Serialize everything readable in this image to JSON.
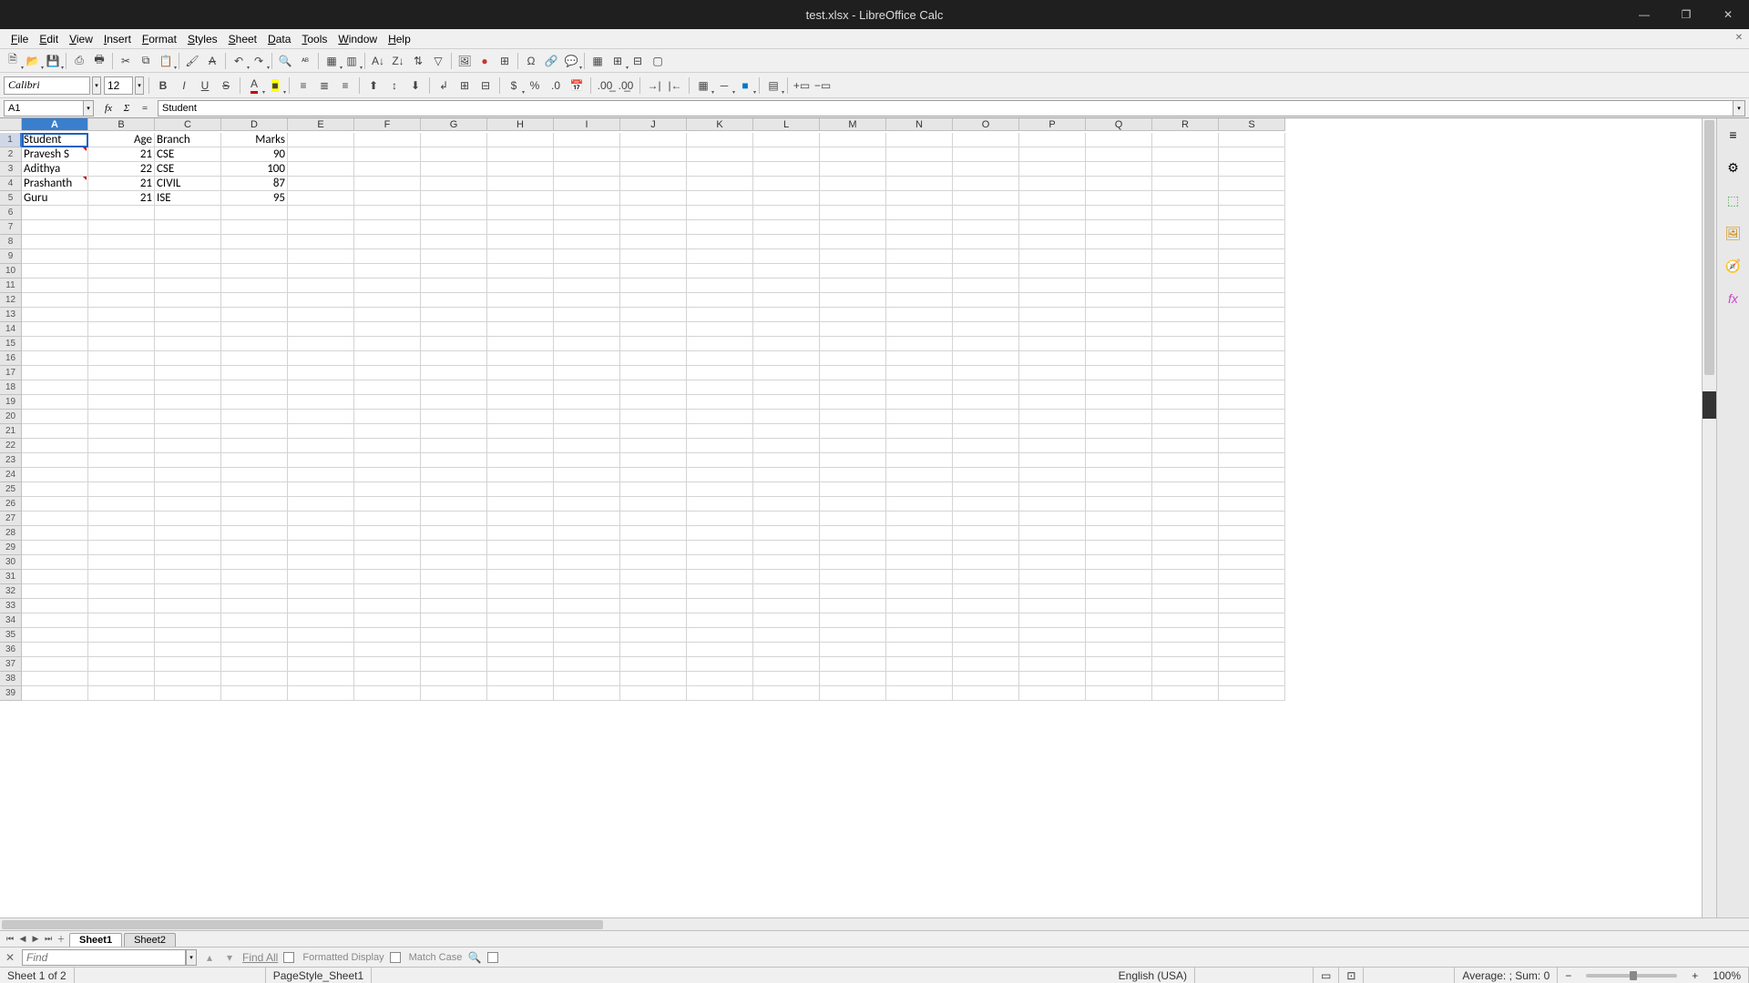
{
  "window": {
    "title": "test.xlsx - LibreOffice Calc"
  },
  "menu": [
    "File",
    "Edit",
    "View",
    "Insert",
    "Format",
    "Styles",
    "Sheet",
    "Data",
    "Tools",
    "Window",
    "Help"
  ],
  "font": {
    "name": "Calibri",
    "size": "12"
  },
  "namebox": "A1",
  "formula": "Student",
  "columns": [
    "A",
    "B",
    "C",
    "D",
    "E",
    "F",
    "G",
    "H",
    "I",
    "J",
    "K",
    "L",
    "M",
    "N",
    "O",
    "P",
    "Q",
    "R",
    "S"
  ],
  "selected_col": "A",
  "selected_row": 1,
  "rows": 39,
  "cells": {
    "A1": "Student",
    "B1": "Age",
    "C1": "Branch",
    "D1": "Marks",
    "A2": "Pravesh S",
    "B2": "21",
    "C2": "CSE",
    "D2": "90",
    "A3": "Adithya",
    "B3": "22",
    "C3": "CSE",
    "D3": "100",
    "A4": "Prashanth",
    "B4": "21",
    "C4": "CIVIL",
    "D4": "87",
    "A5": "Guru",
    "B5": "21",
    "C5": "ISE",
    "D5": "95"
  },
  "numeric_cols": [
    "B",
    "D"
  ],
  "overflow_cells": [
    "A2",
    "A4"
  ],
  "tabs": {
    "active": "Sheet1",
    "list": [
      "Sheet1",
      "Sheet2"
    ]
  },
  "find": {
    "placeholder": "Find",
    "findall": "Find All",
    "formatted": "Formatted Display",
    "matchcase": "Match Case"
  },
  "status": {
    "sheet": "Sheet 1 of 2",
    "pagestyle": "PageStyle_Sheet1",
    "lang": "English (USA)",
    "summary": "Average: ; Sum: 0",
    "zoom": "100%"
  },
  "chart_data": {
    "type": "table",
    "columns": [
      "Student",
      "Age",
      "Branch",
      "Marks"
    ],
    "rows": [
      [
        "Pravesh S",
        21,
        "CSE",
        90
      ],
      [
        "Adithya",
        22,
        "CSE",
        100
      ],
      [
        "Prashanth",
        21,
        "CIVIL",
        87
      ],
      [
        "Guru",
        21,
        "ISE",
        95
      ]
    ]
  }
}
